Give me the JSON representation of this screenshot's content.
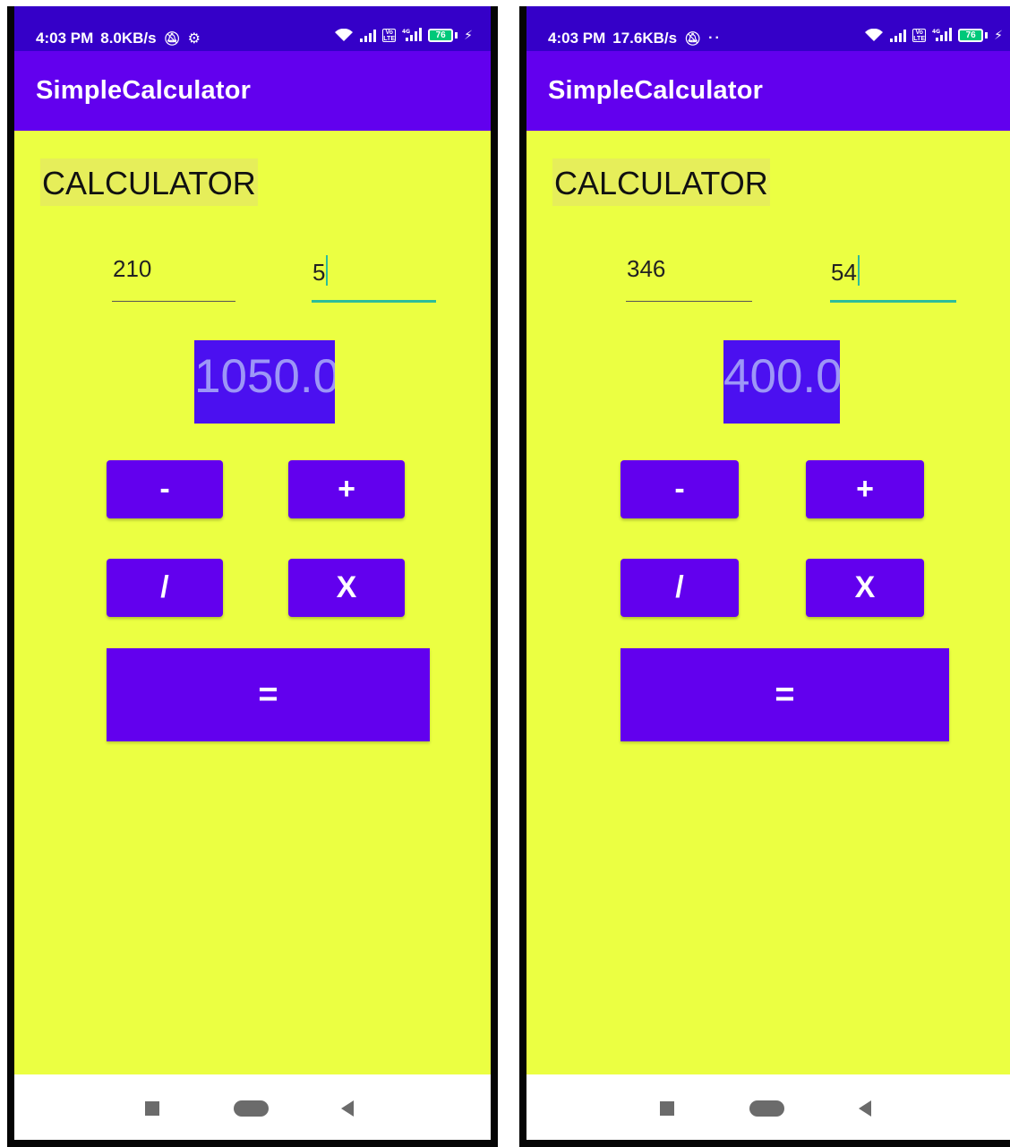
{
  "colors": {
    "status_bar": "#3500c8",
    "app_bar": "#6200ee",
    "background": "#ebff42",
    "button": "#6200ee",
    "result_box": "#4b10f0",
    "focus_underline": "#2dbd9a"
  },
  "screens": [
    {
      "status": {
        "time": "4:03 PM",
        "speed": "8.0KB/s",
        "battery": "76",
        "left_icons": [
          "mute-icon",
          "gear-icon"
        ],
        "right_icons": [
          "wifi-icon",
          "signal-icon",
          "volte-icon",
          "4g-signal-icon",
          "battery-icon",
          "charging-icon"
        ]
      },
      "app_title": "SimpleCalculator",
      "heading": "CALCULATOR",
      "input_1": "210",
      "input_2": "5",
      "focused_input": "input_2",
      "result": "1050.0",
      "buttons": {
        "minus": "-",
        "plus": "+",
        "divide": "/",
        "multiply": "X",
        "equals": "="
      },
      "nav": [
        "recents-button",
        "home-button",
        "back-button"
      ]
    },
    {
      "status": {
        "time": "4:03 PM",
        "speed": "17.6KB/s",
        "battery": "76",
        "left_icons": [
          "mute-icon",
          "more-dots-icon"
        ],
        "right_icons": [
          "wifi-icon",
          "signal-icon",
          "volte-icon",
          "4g-signal-icon",
          "battery-icon",
          "charging-icon"
        ]
      },
      "app_title": "SimpleCalculator",
      "heading": "CALCULATOR",
      "input_1": "346",
      "input_2": "54",
      "focused_input": "input_2",
      "result": "400.0",
      "buttons": {
        "minus": "-",
        "plus": "+",
        "divide": "/",
        "multiply": "X",
        "equals": "="
      },
      "nav": [
        "recents-button",
        "home-button",
        "back-button"
      ]
    }
  ]
}
